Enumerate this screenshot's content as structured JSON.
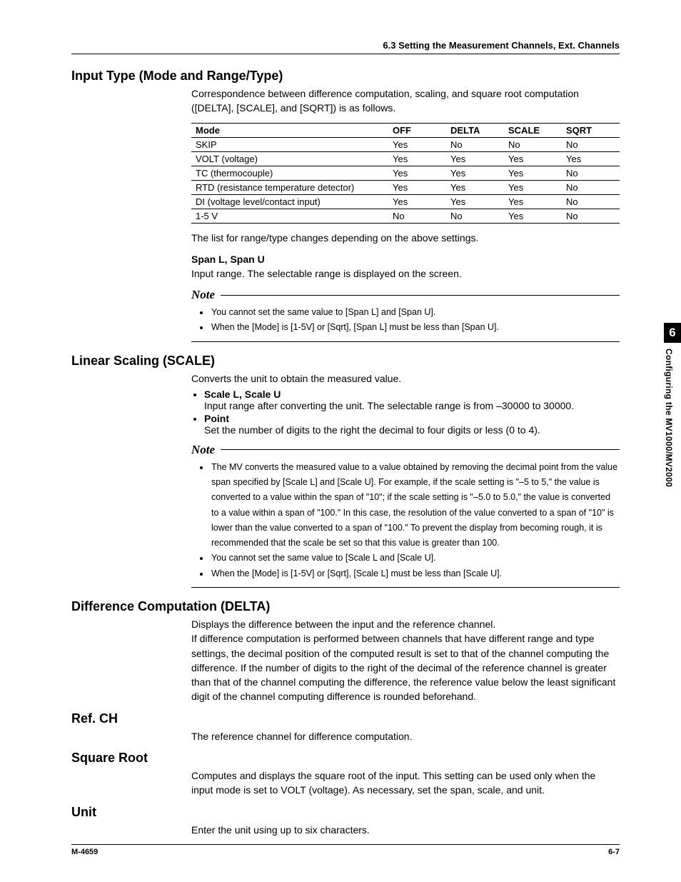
{
  "header": {
    "section_label": "6.3  Setting the Measurement Channels, Ext. Channels"
  },
  "sidetab": {
    "number": "6",
    "label": "Configuring the MV1000/MV2000"
  },
  "footer": {
    "left": "M-4659",
    "right": "6-7"
  },
  "sec1": {
    "title": "Input Type (Mode and Range/Type)",
    "intro": "Correspondence between difference computation, scaling, and square root computation ([DELTA], [SCALE], and [SQRT]) is as follows.",
    "table": {
      "headers": [
        "Mode",
        "OFF",
        "DELTA",
        "SCALE",
        "SQRT"
      ],
      "rows": [
        [
          "SKIP",
          "Yes",
          "No",
          "No",
          "No"
        ],
        [
          "VOLT (voltage)",
          "Yes",
          "Yes",
          "Yes",
          "Yes"
        ],
        [
          "TC (thermocouple)",
          "Yes",
          "Yes",
          "Yes",
          "No"
        ],
        [
          "RTD (resistance temperature detector)",
          "Yes",
          "Yes",
          "Yes",
          "No"
        ],
        [
          "DI (voltage level/contact input)",
          "Yes",
          "Yes",
          "Yes",
          "No"
        ],
        [
          "1-5 V",
          "No",
          "No",
          "Yes",
          "No"
        ]
      ]
    },
    "after_table": "The list for range/type changes depending on the above settings.",
    "span_title": "Span L, Span U",
    "span_body": "Input range.  The selectable range is displayed on the screen.",
    "note_label": "Note",
    "note_items": [
      "You cannot set the same value to [Span L] and [Span U].",
      "When the [Mode] is [1-5V] or [Sqrt], [Span L] must be less than [Span U]."
    ]
  },
  "sec2": {
    "title": "Linear Scaling (SCALE)",
    "intro": "Converts the unit to obtain the measured value.",
    "bullets": [
      {
        "title": "Scale L, Scale U",
        "body": "Input range after converting the unit.  The selectable range is from –30000 to 30000."
      },
      {
        "title": "Point",
        "body": "Set the number of digits to the right the decimal to four digits or less (0 to 4)."
      }
    ],
    "note_label": "Note",
    "note_items": [
      "The MV converts the measured value to a value obtained by removing the decimal point from the value span specified by [Scale L] and [Scale U].  For example, if the scale setting is \"–5 to 5,\" the value is converted to a value within the span of \"10\"; if the scale setting is \"–5.0 to 5.0,\" the value is converted to a value within a span of \"100.\"  In this case, the resolution of the value converted to a span of \"10\" is lower than the value converted to a span of \"100.\"  To prevent the display from becoming rough, it is recommended that the scale be set so that this value is greater than 100.",
      "You cannot set the same value to [Scale L and [Scale U].",
      "When the [Mode] is [1-5V] or [Sqrt], [Scale L] must be less than [Scale U]."
    ]
  },
  "sec3": {
    "title": "Difference Computation (DELTA)",
    "body": "Displays the difference between the input and the reference channel.\nIf difference computation is performed between channels that have different range and type settings, the decimal position of the computed result is set to that of the channel computing the difference.  If the number of digits to the right of the decimal of the reference channel is greater than that of the channel computing the difference, the reference value below the least significant digit of the channel computing difference is rounded beforehand."
  },
  "sec4": {
    "title": "Ref. CH",
    "body": "The reference channel for difference computation."
  },
  "sec5": {
    "title": "Square Root",
    "body": "Computes and displays the square root of the input.  This setting can be used only when the input mode is set to VOLT (voltage).  As necessary, set the span, scale, and unit."
  },
  "sec6": {
    "title": "Unit",
    "body": "Enter the unit using up to six characters."
  }
}
